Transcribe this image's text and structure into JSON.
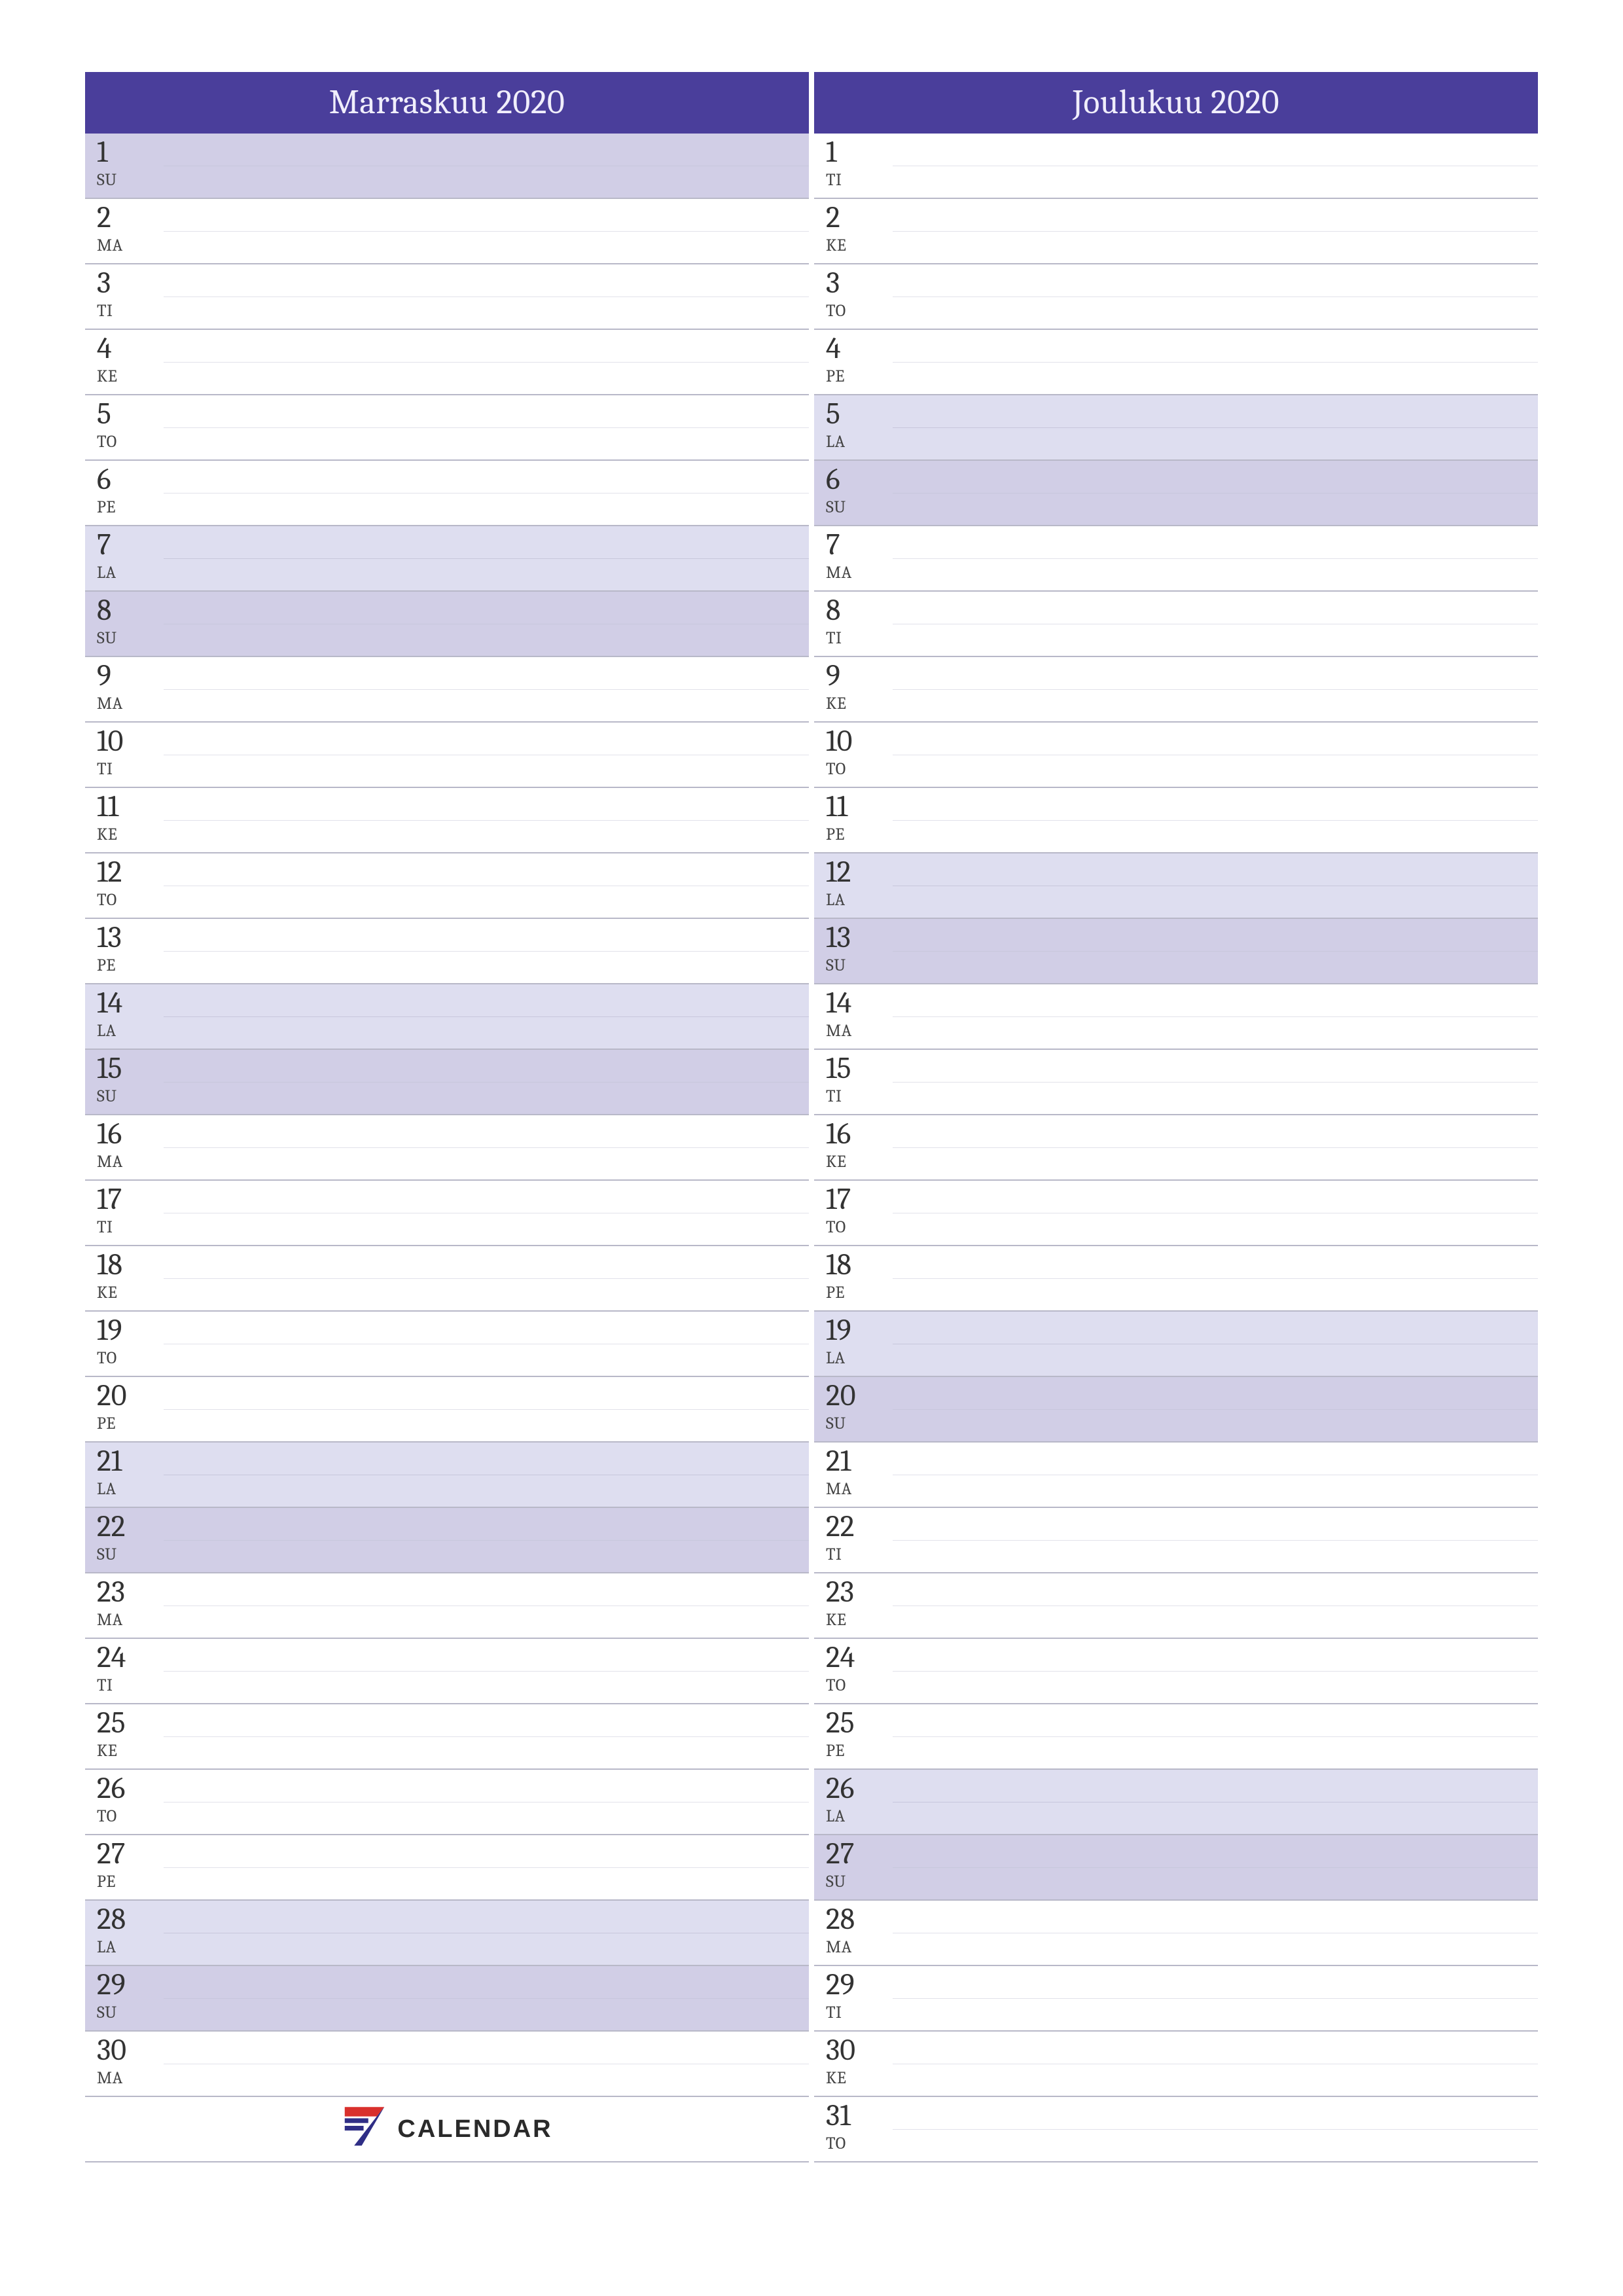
{
  "colors": {
    "header_bg": "#4a3e9b",
    "header_text": "#f0eefb",
    "sat_bg": "#dedef0",
    "sun_bg": "#d1cee6",
    "rule": "#b8b8c8"
  },
  "brand": {
    "label": "CALENDAR"
  },
  "months": [
    {
      "title": "Marraskuu 2020",
      "days": [
        {
          "n": 1,
          "wd": "SU",
          "type": "sun"
        },
        {
          "n": 2,
          "wd": "MA",
          "type": "weekday"
        },
        {
          "n": 3,
          "wd": "TI",
          "type": "weekday"
        },
        {
          "n": 4,
          "wd": "KE",
          "type": "weekday"
        },
        {
          "n": 5,
          "wd": "TO",
          "type": "weekday"
        },
        {
          "n": 6,
          "wd": "PE",
          "type": "weekday"
        },
        {
          "n": 7,
          "wd": "LA",
          "type": "sat"
        },
        {
          "n": 8,
          "wd": "SU",
          "type": "sun"
        },
        {
          "n": 9,
          "wd": "MA",
          "type": "weekday"
        },
        {
          "n": 10,
          "wd": "TI",
          "type": "weekday"
        },
        {
          "n": 11,
          "wd": "KE",
          "type": "weekday"
        },
        {
          "n": 12,
          "wd": "TO",
          "type": "weekday"
        },
        {
          "n": 13,
          "wd": "PE",
          "type": "weekday"
        },
        {
          "n": 14,
          "wd": "LA",
          "type": "sat"
        },
        {
          "n": 15,
          "wd": "SU",
          "type": "sun"
        },
        {
          "n": 16,
          "wd": "MA",
          "type": "weekday"
        },
        {
          "n": 17,
          "wd": "TI",
          "type": "weekday"
        },
        {
          "n": 18,
          "wd": "KE",
          "type": "weekday"
        },
        {
          "n": 19,
          "wd": "TO",
          "type": "weekday"
        },
        {
          "n": 20,
          "wd": "PE",
          "type": "weekday"
        },
        {
          "n": 21,
          "wd": "LA",
          "type": "sat"
        },
        {
          "n": 22,
          "wd": "SU",
          "type": "sun"
        },
        {
          "n": 23,
          "wd": "MA",
          "type": "weekday"
        },
        {
          "n": 24,
          "wd": "TI",
          "type": "weekday"
        },
        {
          "n": 25,
          "wd": "KE",
          "type": "weekday"
        },
        {
          "n": 26,
          "wd": "TO",
          "type": "weekday"
        },
        {
          "n": 27,
          "wd": "PE",
          "type": "weekday"
        },
        {
          "n": 28,
          "wd": "LA",
          "type": "sat"
        },
        {
          "n": 29,
          "wd": "SU",
          "type": "sun"
        },
        {
          "n": 30,
          "wd": "MA",
          "type": "weekday"
        }
      ],
      "trailing_empty": 1,
      "show_brand_in_trailing": true
    },
    {
      "title": "Joulukuu 2020",
      "days": [
        {
          "n": 1,
          "wd": "TI",
          "type": "weekday"
        },
        {
          "n": 2,
          "wd": "KE",
          "type": "weekday"
        },
        {
          "n": 3,
          "wd": "TO",
          "type": "weekday"
        },
        {
          "n": 4,
          "wd": "PE",
          "type": "weekday"
        },
        {
          "n": 5,
          "wd": "LA",
          "type": "sat"
        },
        {
          "n": 6,
          "wd": "SU",
          "type": "sun"
        },
        {
          "n": 7,
          "wd": "MA",
          "type": "weekday"
        },
        {
          "n": 8,
          "wd": "TI",
          "type": "weekday"
        },
        {
          "n": 9,
          "wd": "KE",
          "type": "weekday"
        },
        {
          "n": 10,
          "wd": "TO",
          "type": "weekday"
        },
        {
          "n": 11,
          "wd": "PE",
          "type": "weekday"
        },
        {
          "n": 12,
          "wd": "LA",
          "type": "sat"
        },
        {
          "n": 13,
          "wd": "SU",
          "type": "sun"
        },
        {
          "n": 14,
          "wd": "MA",
          "type": "weekday"
        },
        {
          "n": 15,
          "wd": "TI",
          "type": "weekday"
        },
        {
          "n": 16,
          "wd": "KE",
          "type": "weekday"
        },
        {
          "n": 17,
          "wd": "TO",
          "type": "weekday"
        },
        {
          "n": 18,
          "wd": "PE",
          "type": "weekday"
        },
        {
          "n": 19,
          "wd": "LA",
          "type": "sat"
        },
        {
          "n": 20,
          "wd": "SU",
          "type": "sun"
        },
        {
          "n": 21,
          "wd": "MA",
          "type": "weekday"
        },
        {
          "n": 22,
          "wd": "TI",
          "type": "weekday"
        },
        {
          "n": 23,
          "wd": "KE",
          "type": "weekday"
        },
        {
          "n": 24,
          "wd": "TO",
          "type": "weekday"
        },
        {
          "n": 25,
          "wd": "PE",
          "type": "weekday"
        },
        {
          "n": 26,
          "wd": "LA",
          "type": "sat"
        },
        {
          "n": 27,
          "wd": "SU",
          "type": "sun"
        },
        {
          "n": 28,
          "wd": "MA",
          "type": "weekday"
        },
        {
          "n": 29,
          "wd": "TI",
          "type": "weekday"
        },
        {
          "n": 30,
          "wd": "KE",
          "type": "weekday"
        },
        {
          "n": 31,
          "wd": "TO",
          "type": "weekday"
        }
      ],
      "trailing_empty": 0,
      "show_brand_in_trailing": false
    }
  ]
}
